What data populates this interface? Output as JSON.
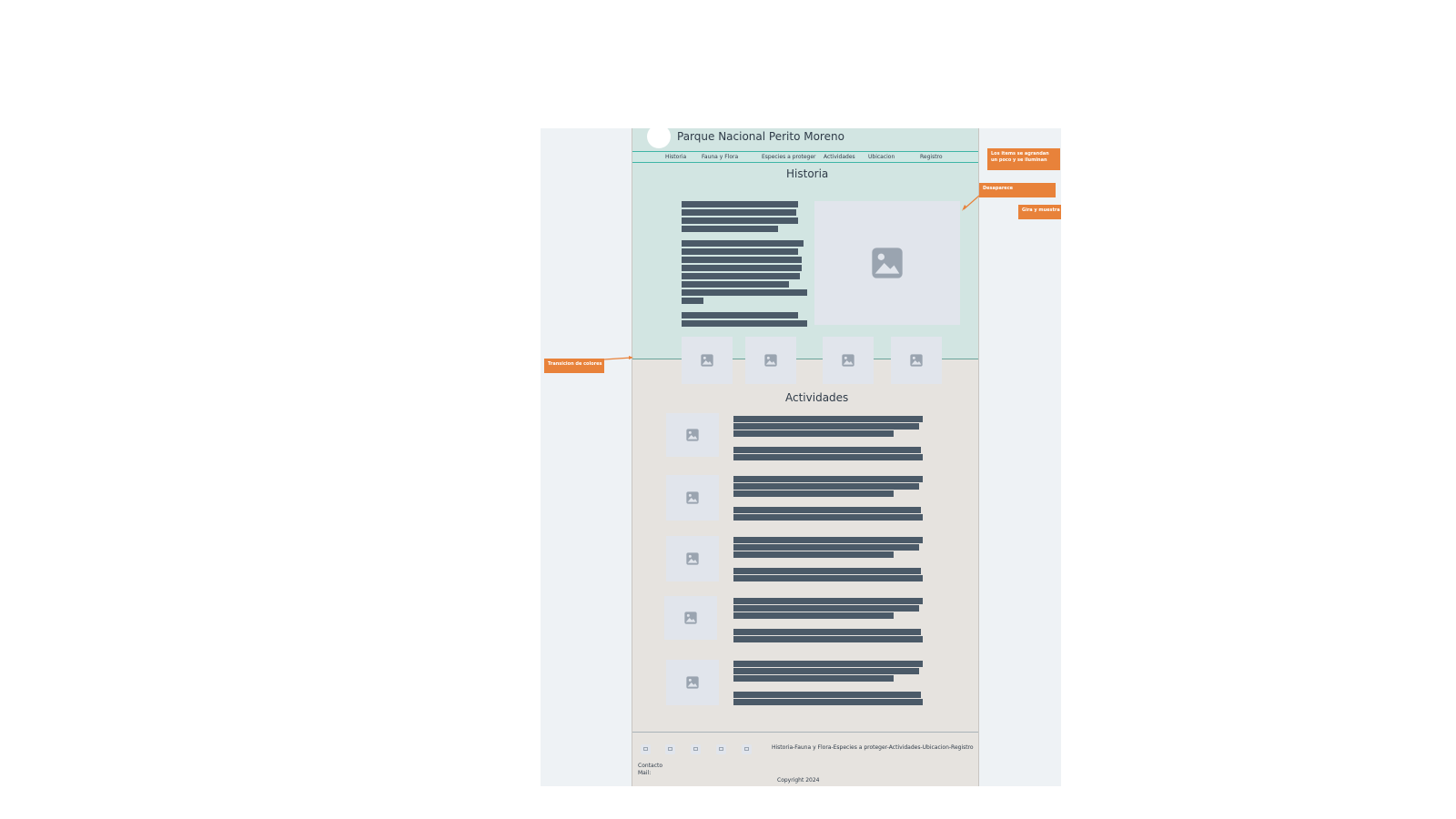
{
  "header": {
    "site_title": "Parque Nacional Perito Moreno"
  },
  "nav": {
    "items": [
      {
        "label": "Historia"
      },
      {
        "label": "Fauna y Flora"
      },
      {
        "label": "Especies a proteger"
      },
      {
        "label": "Actividades"
      },
      {
        "label": "Ubicacion"
      },
      {
        "label": "Registro"
      }
    ]
  },
  "historia": {
    "title": "Historia"
  },
  "actividades": {
    "title": "Actividades"
  },
  "footer": {
    "links": "Historia-Fauna y Flora-Especies a proteger-Actividades-Ubicacion-Registro",
    "contact": "Contacto",
    "mail": "Mail:",
    "copyright": "Copyright 2024"
  },
  "annotations": {
    "nav_hover": "Los items se agrandan un poco y se iluminan",
    "disappears": "Desaparece",
    "rotate": "Gira y muestra",
    "color_transition": "Transicion de colores"
  },
  "colors": {
    "top_section": "#d2e5e2",
    "body_section": "#e6e3df",
    "text_block": "#4b5a68",
    "annotation": "#e8823a",
    "nav_border": "#3fb5a6"
  },
  "icons": {
    "image_placeholder": "image-icon",
    "social": "social-icon",
    "logo": "logo-circle"
  }
}
